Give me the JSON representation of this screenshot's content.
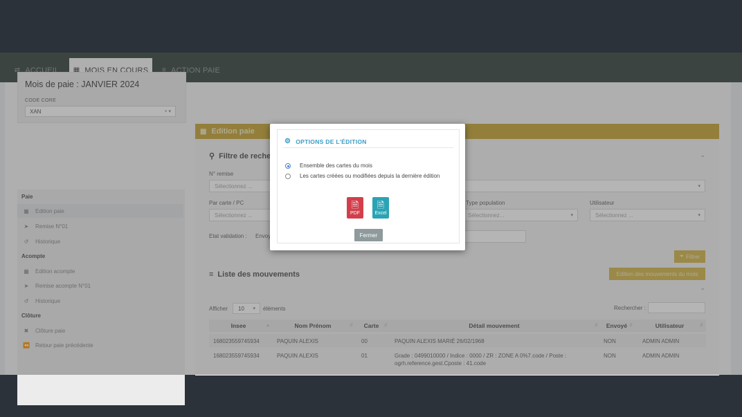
{
  "tabs": [
    {
      "label": "ACCUEIL",
      "icon": "arrows-icon"
    },
    {
      "label": "MOIS EN COURS",
      "icon": "calendar-icon"
    },
    {
      "label": "ACTION PAIE",
      "icon": "list-icon"
    }
  ],
  "left": {
    "title": "Mois de paie : JANVIER 2024",
    "code_label": "CODE CORE",
    "code_value": "XAN"
  },
  "sidebar": {
    "sections": [
      "Paie",
      "Acompte",
      "Clôture"
    ],
    "paie_items": [
      "Edition paie",
      "Remise N°01",
      "Historique"
    ],
    "acompte_items": [
      "Edition acompte",
      "Remise acompte N°01",
      "Historique"
    ],
    "cloture_items": [
      "Clôture paie",
      "Retour paie précédente"
    ]
  },
  "main": {
    "header": "Edition paie",
    "filter_title": "Filtre de reche",
    "f_remise": "N° remise",
    "f_remise_ph": "Sélectionnez ...",
    "f_carte": "Par carte / PC",
    "f_carte_ph": "Sélectionnez ...",
    "f_type": "Type population",
    "f_type_ph": "Sélectionnez...",
    "f_user": "Utilisateur",
    "f_user_ph": "Sélectionnez ...",
    "f_etat": "Etat validation :",
    "f_etat_val": "Envoy",
    "filter_btn": "Filtrer",
    "list_title": "Liste des mouvements",
    "edition_btn": "Edition des mouvements du mois",
    "show_prefix": "Afficher",
    "show_value": "10",
    "show_suffix": "éléments",
    "search_label": "Rechercher :"
  },
  "table": {
    "headers": [
      "Insee",
      "Nom Prénom",
      "Carte",
      "Détail mouvement",
      "Envoyé",
      "Utilisateur"
    ],
    "rows": [
      {
        "insee": "168023559745934",
        "nom": "PAQUIN ALEXIS",
        "carte": "00",
        "detail": "PAQUIN ALEXIS MARIÉ 26/02/1968",
        "detail2": "",
        "envoye": "NON",
        "user": "ADMIN ADMIN"
      },
      {
        "insee": "168023559745934",
        "nom": "PAQUIN ALEXIS",
        "carte": "01",
        "detail": "Grade : 0499010000 / Indice : 0000 / ZR : ZONE A 0%7.code / Poste :",
        "detail2": "ogrh.reference.gest.Cposte : 41.code",
        "envoye": "NON",
        "user": "ADMIN ADMIN"
      }
    ]
  },
  "modal": {
    "title": "OPTIONS DE L'ÉDITION",
    "option1": "Ensemble des cartes du mois",
    "option2": "Les cartes créées ou modifiées depuis la dernière édition",
    "pdf_label": "PDF",
    "excel_label": "Excel",
    "close": "Fermer"
  }
}
